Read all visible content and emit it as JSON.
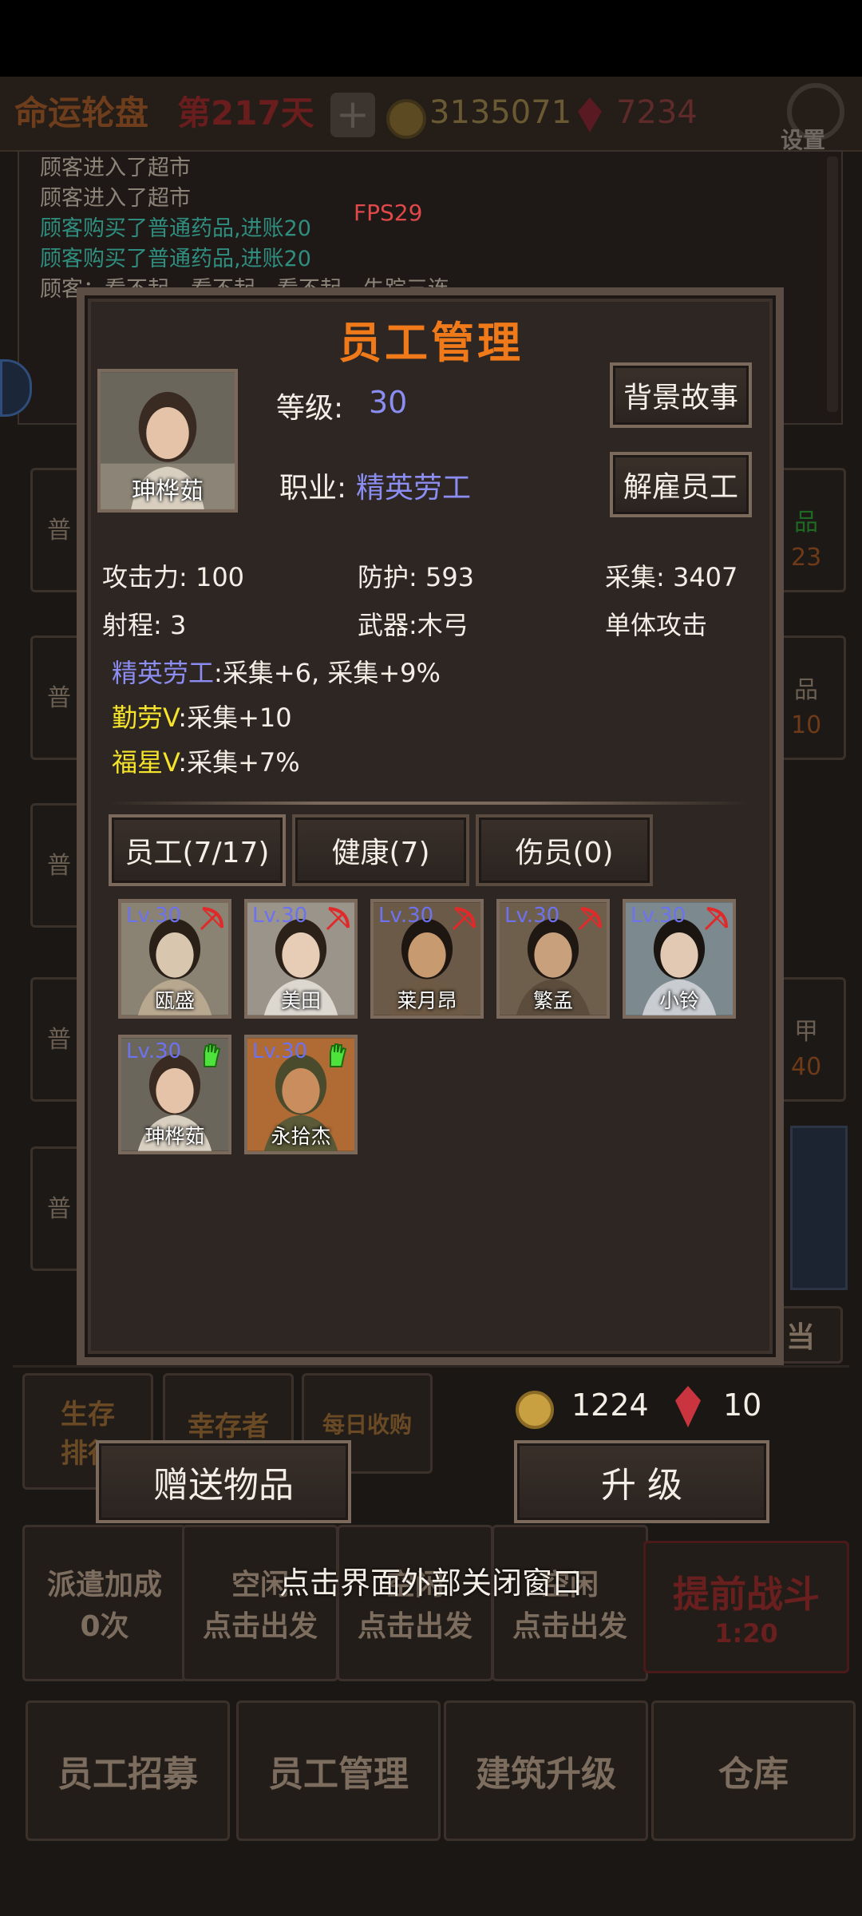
{
  "background": {
    "top": {
      "title": "命运轮盘",
      "day": "第217天",
      "coins": "3135071",
      "gems": "7234",
      "settings": "设置"
    },
    "log": [
      {
        "text": "顾客进入了超市",
        "green": false
      },
      {
        "text": "顾客进入了超市",
        "green": false
      },
      {
        "text": "顾客购买了普通药品,进账20",
        "green": true
      },
      {
        "text": "顾客购买了普通药品,进账20",
        "green": true
      },
      {
        "text": "顾客：看不起，看不起，看不起，失踪三连",
        "green": false
      }
    ],
    "fps": "FPS29",
    "left_tags": [
      "普",
      "普",
      "普",
      "普",
      "普"
    ],
    "right_tags": [
      "品",
      "品",
      "甲"
    ],
    "right_nums": [
      "23",
      "10",
      "40"
    ],
    "shop_label": "当",
    "bottom_tabs": [
      "生存排行",
      "幸存者",
      "每日收购"
    ],
    "dispatch": {
      "label": "派遣加成",
      "count": "0次",
      "slots": [
        "空闲",
        "空闲",
        "空闲"
      ],
      "go": "点击出发",
      "battle": "提前战斗",
      "timer": "1:20"
    },
    "main_nav": [
      "员工招募",
      "员工管理",
      "建筑升级",
      "仓库"
    ]
  },
  "dialog": {
    "title": "员工管理",
    "portrait_name": "珅桦茹",
    "level_label": "等级:",
    "level_value": "30",
    "job_label": "职业:",
    "job_value": "精英劳工",
    "backstory_button": "背景故事",
    "fire_button": "解雇员工",
    "stats": {
      "attack": "攻击力: 100",
      "defense": "防护: 593",
      "gather": "采集: 3407",
      "range": "射程: 3",
      "weapon": "武器:木弓",
      "attack_type": "单体攻击"
    },
    "traits": [
      {
        "name": "精英劳工",
        "effect": ":采集+6, 采集+9%",
        "color": "purple"
      },
      {
        "name": "勤劳V",
        "effect": ":采集+10",
        "color": "yellow"
      },
      {
        "name": "福星V",
        "effect": ":采集+7%",
        "color": "yellow"
      }
    ],
    "tabs": [
      "员工(7/17)",
      "健康(7)",
      "伤员(0)"
    ],
    "employees": [
      {
        "name": "瓯盛",
        "level": "Lv.30",
        "icon": "bow-icon"
      },
      {
        "name": "美田",
        "level": "Lv.30",
        "icon": "bow-icon"
      },
      {
        "name": "莱月昂",
        "level": "Lv.30",
        "icon": "bow-icon"
      },
      {
        "name": "繁孟",
        "level": "Lv.30",
        "icon": "bow-icon"
      },
      {
        "name": "小铃",
        "level": "Lv.30",
        "icon": "bow-icon"
      },
      {
        "name": "珅桦茹",
        "level": "Lv.30",
        "icon": "glove-icon"
      },
      {
        "name": "永拾杰",
        "level": "Lv.30",
        "icon": "glove-icon"
      }
    ]
  },
  "footer": {
    "gold": "1224",
    "gems": "10",
    "gift_button": "赠送物品",
    "upgrade_button": "升 级",
    "close_hint": "点击界面外部关闭窗口"
  }
}
